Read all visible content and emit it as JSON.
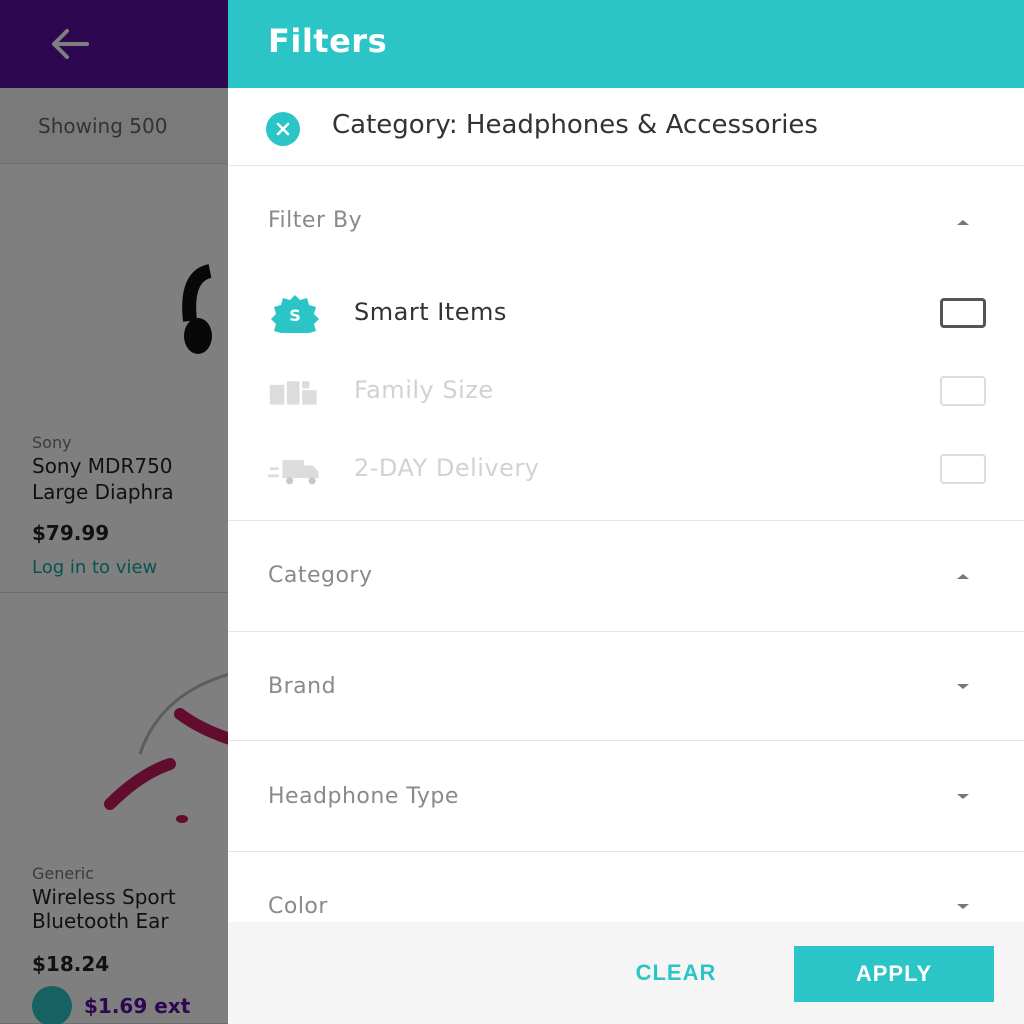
{
  "background": {
    "results_count": "Showing 500",
    "products": [
      {
        "brand": "Sony",
        "title_line1": "Sony MDR750",
        "title_line2": "Large Diaphra",
        "price": "$79.99",
        "link": "Log in to view"
      },
      {
        "brand": "Generic",
        "title_line1": "Wireless Sport",
        "title_line2": "Bluetooth Ear",
        "price": "$18.24",
        "promo": "$1.69 ext"
      }
    ]
  },
  "drawer": {
    "title": "Filters",
    "active_chip": {
      "label": "Category: Headphones & Accessories",
      "icon": "close-icon"
    },
    "filter_by": {
      "label": "Filter By",
      "expanded": true,
      "options": [
        {
          "label": "Smart Items",
          "icon": "smart-badge-icon",
          "checked": false,
          "enabled": true
        },
        {
          "label": "Family Size",
          "icon": "family-size-icon",
          "checked": false,
          "enabled": false
        },
        {
          "label": "2-DAY Delivery",
          "icon": "delivery-truck-icon",
          "checked": false,
          "enabled": false
        }
      ]
    },
    "sections": [
      {
        "label": "Category",
        "expanded": true
      },
      {
        "label": "Brand",
        "expanded": false
      },
      {
        "label": "Headphone Type",
        "expanded": false
      },
      {
        "label": "Color",
        "expanded": false
      }
    ],
    "footer": {
      "clear_label": "CLEAR",
      "apply_label": "APPLY"
    }
  },
  "colors": {
    "primary_teal": "#2cc5c7",
    "header_purple": "#5b0fa0"
  }
}
